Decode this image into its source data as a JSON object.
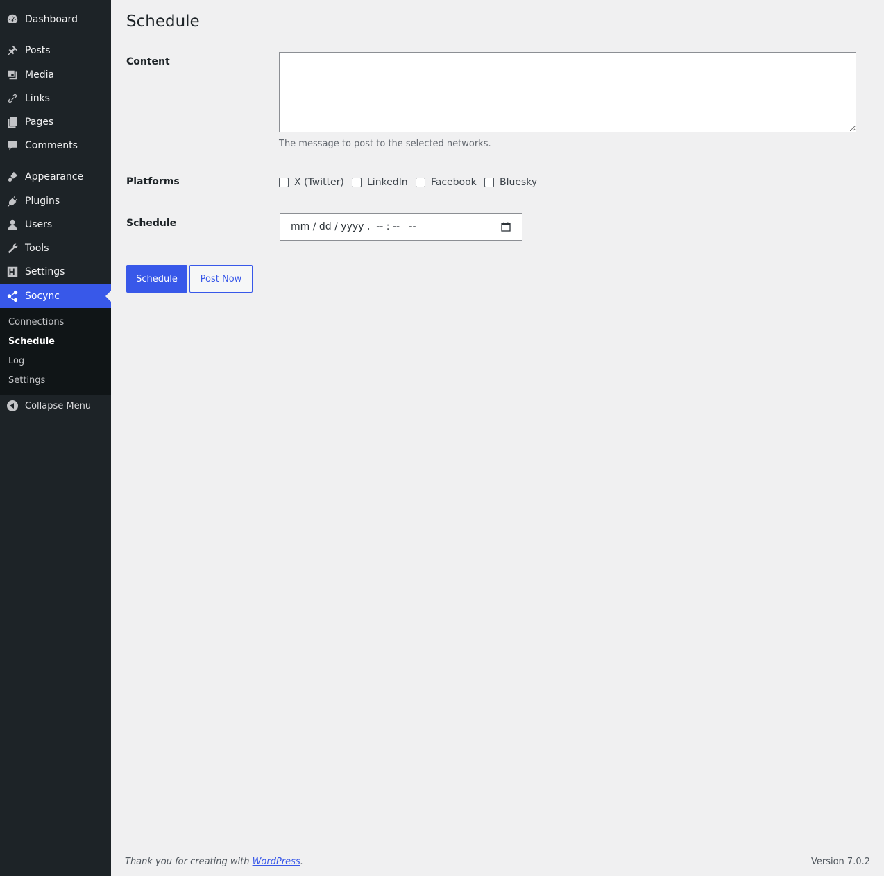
{
  "sidebar": {
    "items": [
      {
        "label": "Dashboard",
        "icon": "dashboard-icon"
      },
      {
        "label": "Posts",
        "icon": "pin-icon"
      },
      {
        "label": "Media",
        "icon": "media-icon"
      },
      {
        "label": "Links",
        "icon": "link-icon"
      },
      {
        "label": "Pages",
        "icon": "pages-icon"
      },
      {
        "label": "Comments",
        "icon": "comment-icon"
      },
      {
        "label": "Appearance",
        "icon": "brush-icon"
      },
      {
        "label": "Plugins",
        "icon": "plug-icon"
      },
      {
        "label": "Users",
        "icon": "user-icon"
      },
      {
        "label": "Tools",
        "icon": "wrench-icon"
      },
      {
        "label": "Settings",
        "icon": "sliders-icon"
      },
      {
        "label": "Socync",
        "icon": "share-icon"
      }
    ],
    "submenu": [
      "Connections",
      "Schedule",
      "Log",
      "Settings"
    ],
    "collapse_label": "Collapse Menu",
    "active_color": "#3858e9"
  },
  "page": {
    "title": "Schedule",
    "content_label": "Content",
    "content_value": "",
    "content_help": "The message to post to the selected networks.",
    "platforms_label": "Platforms",
    "platforms": [
      "X (Twitter)",
      "LinkedIn",
      "Facebook",
      "Bluesky"
    ],
    "schedule_label": "Schedule",
    "schedule_placeholder": "mm / dd / yyyy ,  -- : --   --",
    "schedule_button": "Schedule",
    "post_now_button": "Post Now"
  },
  "footer": {
    "thanks_prefix": "Thank you for creating with ",
    "thanks_link": "WordPress",
    "thanks_suffix": ".",
    "version": "Version 7.0.2"
  }
}
